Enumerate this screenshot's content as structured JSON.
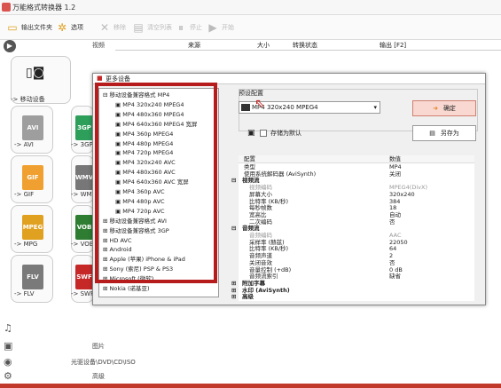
{
  "app": {
    "title": "万能格式转换器 1.2"
  },
  "toolbar": {
    "output_folder": "输出文件夹",
    "options": "选项",
    "remove": "移除",
    "clear_list": "清空列表",
    "stop": "停止",
    "start": "开始"
  },
  "sidebar": {
    "video": "视频",
    "mobile": "-> 移动设备",
    "picture": "图片",
    "disc": "光驱设备\\DVD\\CD\\ISO",
    "advanced": "高级",
    "formats": [
      {
        "name": "AVI",
        "label": "-> AVI",
        "color": "#9e9e9e"
      },
      {
        "name": "GIF",
        "label": "-> GIF",
        "color": "#f0a030"
      },
      {
        "name": "MPEG",
        "label": "-> MPG",
        "color": "#e0a020"
      },
      {
        "name": "FLV",
        "label": "-> FLV",
        "color": "#7a7a7a"
      }
    ],
    "formats2": [
      {
        "name": "3GP",
        "label": "-> 3GP",
        "color": "#2e9e5b"
      },
      {
        "name": "WMV",
        "label": "-> WMV",
        "color": "#777"
      },
      {
        "name": "VOB",
        "label": "-> VOB",
        "color": "#2e7d32"
      },
      {
        "name": "SWF",
        "label": "-> SWF",
        "color": "#c62828"
      }
    ]
  },
  "columns": {
    "source": "来源",
    "size": "大小",
    "status": "转换状态",
    "output": "输出 [F2]"
  },
  "dialog": {
    "title": "更多设备",
    "preset_label": "预设配置",
    "preset_value": "MP4 320x240 MPEG4",
    "save_default": "存储为默认",
    "ok": "确定",
    "save_as": "另存为",
    "tree": [
      {
        "t": "移动设备兼容格式 MP4",
        "lvl": 0,
        "open": true
      },
      {
        "t": "MP4 320x240 MPEG4",
        "lvl": 1
      },
      {
        "t": "MP4 480x360 MPEG4",
        "lvl": 1
      },
      {
        "t": "MP4 640x360 MPEG4 宽屏",
        "lvl": 1
      },
      {
        "t": "MP4 360p MPEG4",
        "lvl": 1
      },
      {
        "t": "MP4 480p MPEG4",
        "lvl": 1
      },
      {
        "t": "MP4 720p MPEG4",
        "lvl": 1
      },
      {
        "t": "MP4 320x240 AVC",
        "lvl": 1
      },
      {
        "t": "MP4 480x360 AVC",
        "lvl": 1
      },
      {
        "t": "MP4 640x360 AVC 宽屏",
        "lvl": 1
      },
      {
        "t": "MP4 360p AVC",
        "lvl": 1
      },
      {
        "t": "MP4 480p AVC",
        "lvl": 1
      },
      {
        "t": "MP4 720p AVC",
        "lvl": 1
      },
      {
        "t": "移动设备兼容格式 AVI",
        "lvl": 0
      },
      {
        "t": "移动设备兼容格式 3GP",
        "lvl": 0
      },
      {
        "t": "HD AVC",
        "lvl": 0
      },
      {
        "t": "Android",
        "lvl": 0
      },
      {
        "t": "Apple (苹果) iPhone & iPad",
        "lvl": 0
      },
      {
        "t": "Sony (索尼) PSP & PS3",
        "lvl": 0
      },
      {
        "t": "Microsoft (微软)",
        "lvl": 0
      },
      {
        "t": "Nokia (诺基亚)",
        "lvl": 0
      }
    ],
    "props_header": {
      "name": "配置",
      "value": "数值"
    },
    "props": [
      {
        "n": "类型",
        "v": "MP4",
        "k": ""
      },
      {
        "n": "使用系统解码器 (AviSynth)",
        "v": "关闭",
        "k": ""
      },
      {
        "n": "视频流",
        "v": "",
        "k": "g",
        "mark": "⊟"
      },
      {
        "n": "视频编码",
        "v": "MPEG4(DivX)",
        "k": "sub dim"
      },
      {
        "n": "屏幕大小",
        "v": "320x240",
        "k": "sub"
      },
      {
        "n": "比特率 (KB/秒)",
        "v": "384",
        "k": "sub"
      },
      {
        "n": "每秒帧数",
        "v": "18",
        "k": "sub"
      },
      {
        "n": "宽高比",
        "v": "自动",
        "k": "sub"
      },
      {
        "n": "二次编码",
        "v": "否",
        "k": "sub"
      },
      {
        "n": "音频流",
        "v": "",
        "k": "g",
        "mark": "⊟"
      },
      {
        "n": "音频编码",
        "v": "AAC",
        "k": "sub dim"
      },
      {
        "n": "采样率 (赫兹)",
        "v": "22050",
        "k": "sub"
      },
      {
        "n": "比特率 (KB/秒)",
        "v": "64",
        "k": "sub"
      },
      {
        "n": "音频声道",
        "v": "2",
        "k": "sub"
      },
      {
        "n": "关闭音效",
        "v": "否",
        "k": "sub"
      },
      {
        "n": "音量控制 (+dB)",
        "v": "0 dB",
        "k": "sub"
      },
      {
        "n": "音频流索引",
        "v": "缺省",
        "k": "sub"
      },
      {
        "n": "附加字幕",
        "v": "",
        "k": "g",
        "mark": "⊞"
      },
      {
        "n": "水印 (AviSynth)",
        "v": "",
        "k": "g",
        "mark": "⊞"
      },
      {
        "n": "高级",
        "v": "",
        "k": "g",
        "mark": "⊞"
      }
    ]
  }
}
